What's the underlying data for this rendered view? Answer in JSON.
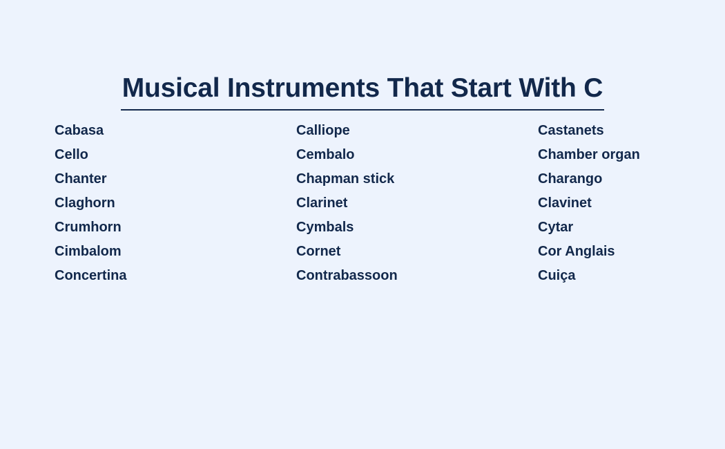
{
  "document": {
    "title": "Musical Instruments That Start With C",
    "background_color": "#edf3fd",
    "text_color": "#12284b"
  },
  "columns": [
    {
      "items": [
        "Cabasa",
        "Cello",
        "Chanter",
        "Claghorn",
        "Crumhorn",
        "Cimbalom",
        "Concertina"
      ]
    },
    {
      "items": [
        "Calliope",
        "Cembalo",
        "Chapman stick",
        "Clarinet",
        "Cymbals",
        "Cornet",
        "Contrabassoon"
      ]
    },
    {
      "items": [
        "Castanets",
        "Chamber organ",
        "Charango",
        "Clavinet",
        "Cytar",
        "Cor Anglais",
        "Cuiça"
      ]
    }
  ]
}
